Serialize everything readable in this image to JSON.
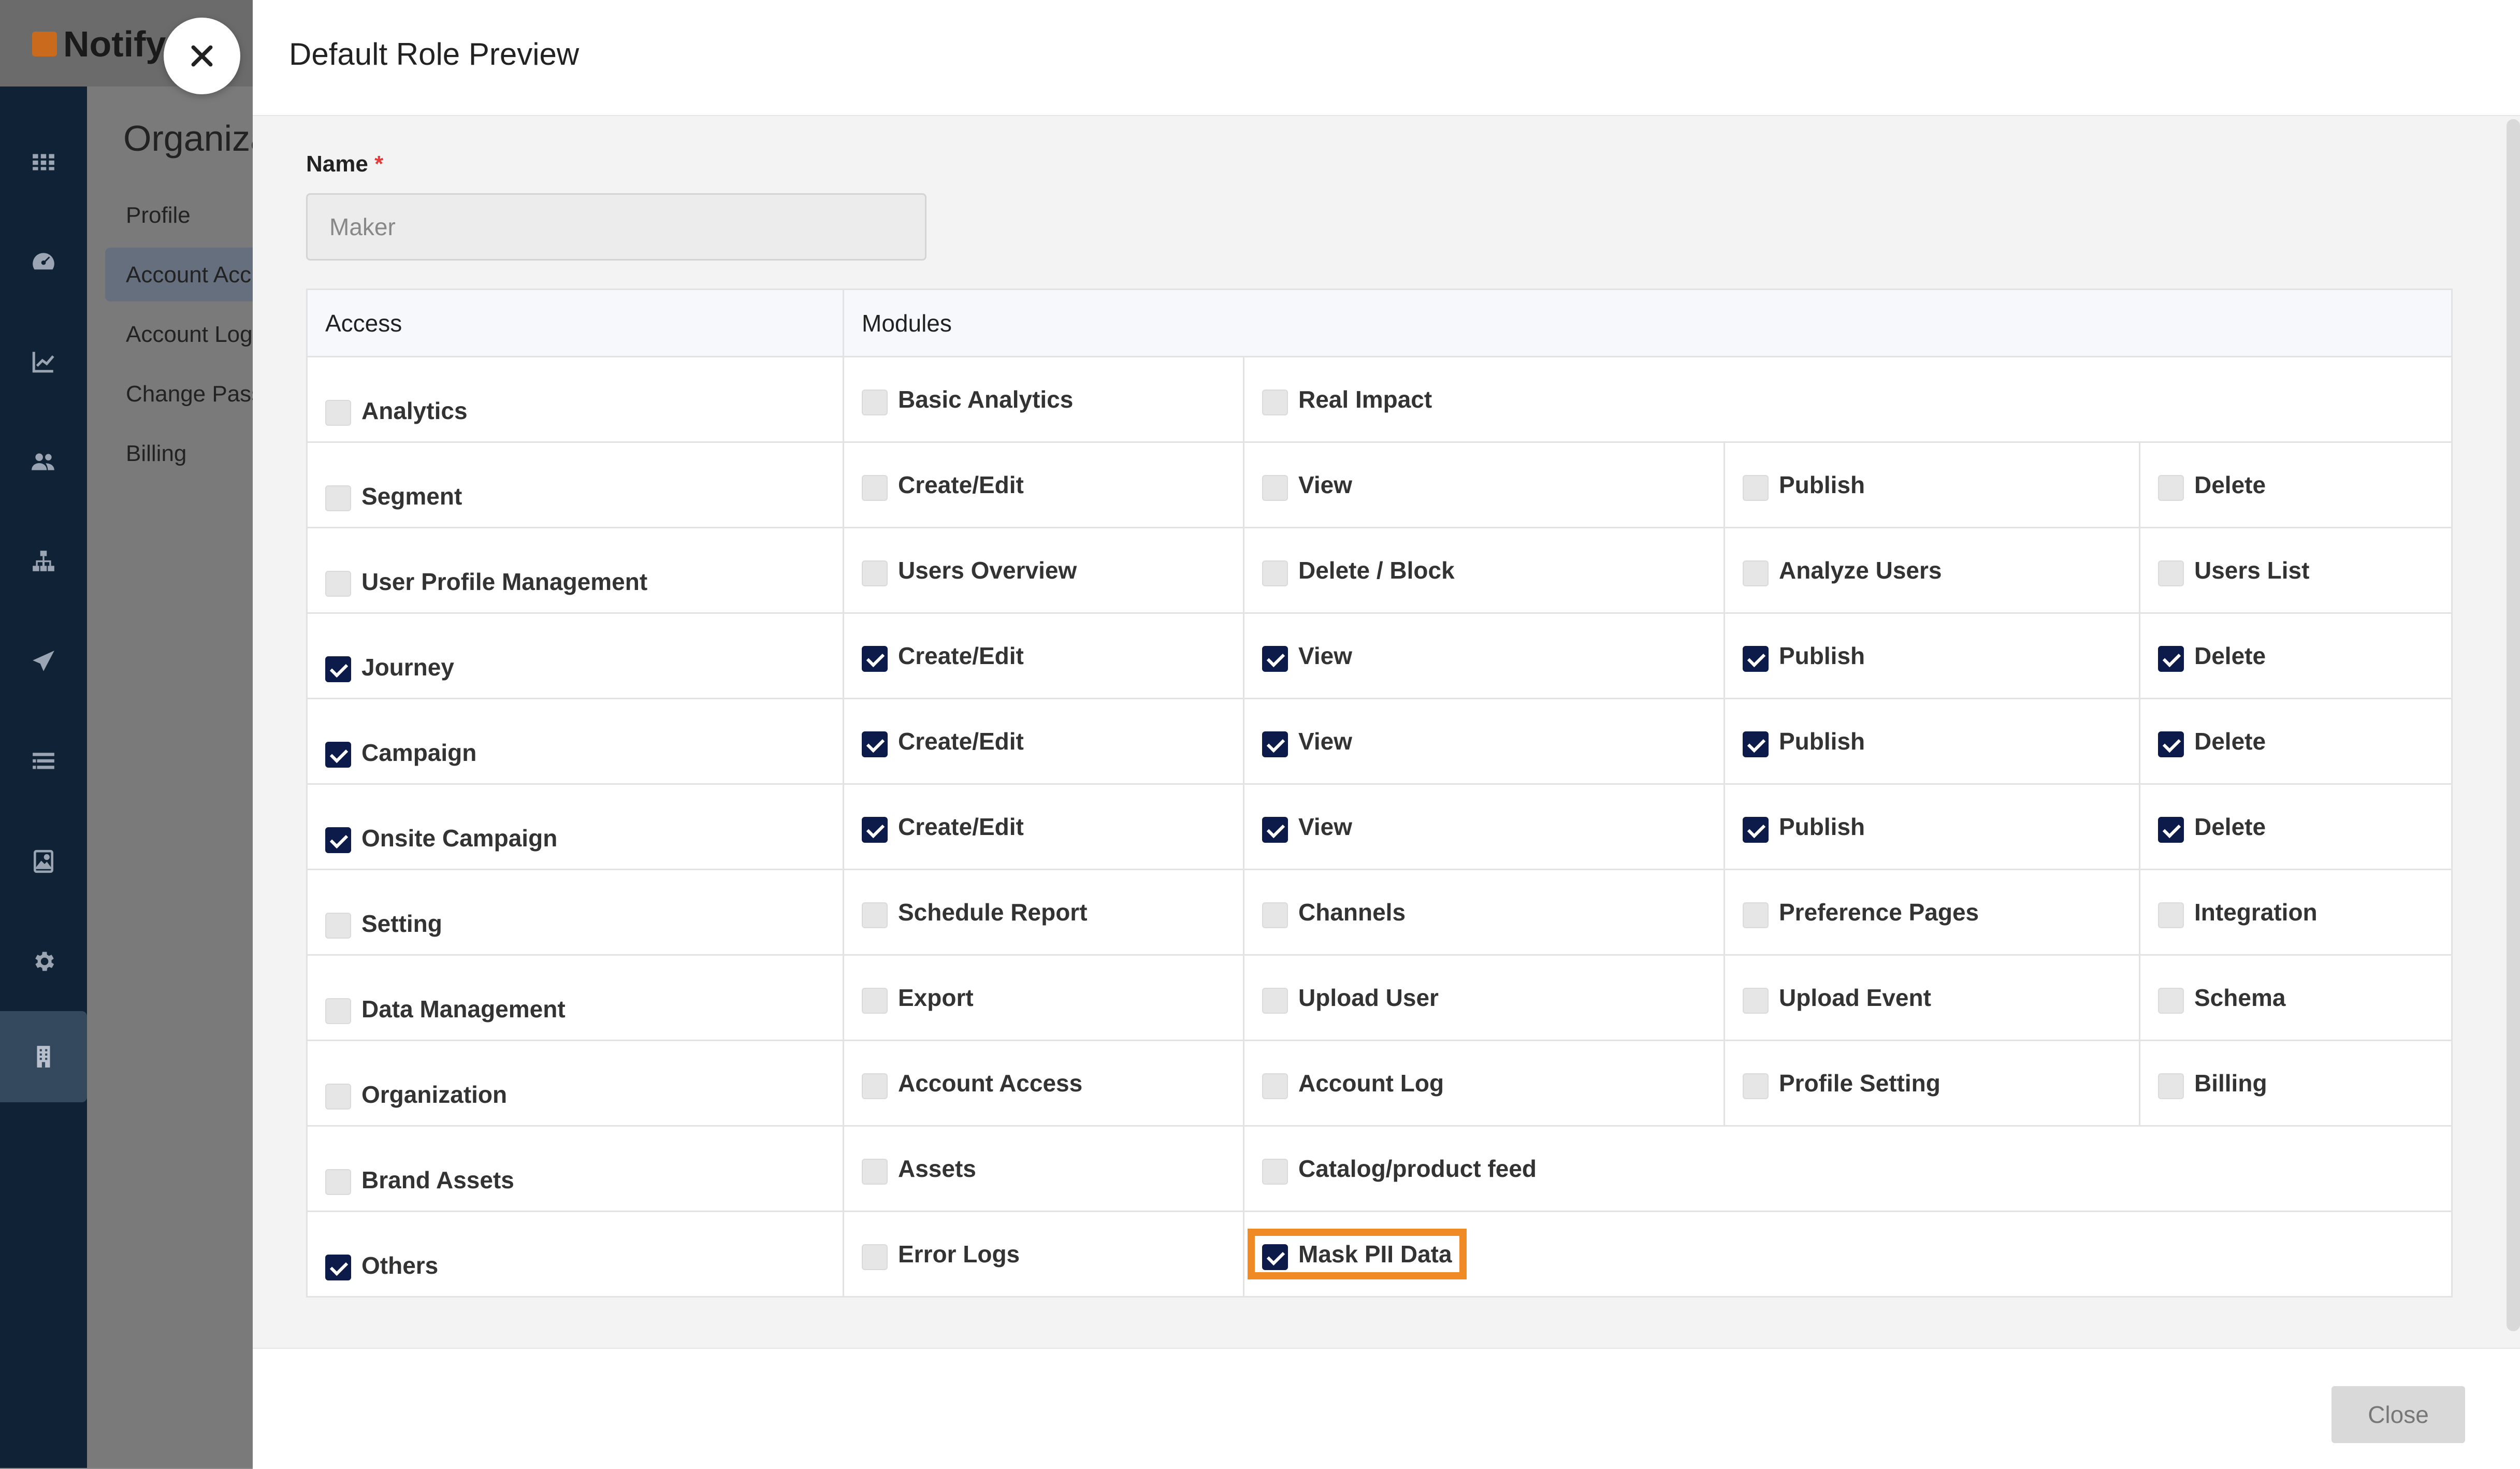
{
  "app": {
    "logo_text": "Notify"
  },
  "sidebar": {
    "icons": [
      "apps-icon",
      "dashboard-icon",
      "chart-icon",
      "users-icon",
      "hierarchy-icon",
      "send-icon",
      "list-icon",
      "image-icon",
      "gear-icon",
      "building-icon"
    ]
  },
  "subnav": {
    "title": "Organiza",
    "items": [
      {
        "label": "Profile"
      },
      {
        "label": "Account Acc"
      },
      {
        "label": "Account Log"
      },
      {
        "label": "Change Pass"
      },
      {
        "label": "Billing"
      }
    ]
  },
  "modal": {
    "title": "Default Role Preview",
    "name_label": "Name",
    "required_mark": "*",
    "name_value": "Maker",
    "close_label": "Close",
    "highlight_color": "#f08a24",
    "checkbox_checked_color": "#0d1b4a"
  },
  "table": {
    "headers": {
      "access": "Access",
      "modules": "Modules"
    },
    "rows": [
      {
        "access": {
          "label": "Analytics",
          "checked": false
        },
        "modules": [
          {
            "label": "Basic Analytics",
            "checked": false
          },
          {
            "label": "Real Impact",
            "checked": false
          }
        ]
      },
      {
        "access": {
          "label": "Segment",
          "checked": false
        },
        "modules": [
          {
            "label": "Create/Edit",
            "checked": false
          },
          {
            "label": "View",
            "checked": false
          },
          {
            "label": "Publish",
            "checked": false
          },
          {
            "label": "Delete",
            "checked": false
          }
        ]
      },
      {
        "access": {
          "label": "User Profile Management",
          "checked": false
        },
        "modules": [
          {
            "label": "Users Overview",
            "checked": false
          },
          {
            "label": "Delete / Block",
            "checked": false
          },
          {
            "label": "Analyze Users",
            "checked": false
          },
          {
            "label": "Users List",
            "checked": false
          }
        ]
      },
      {
        "access": {
          "label": "Journey",
          "checked": true
        },
        "modules": [
          {
            "label": "Create/Edit",
            "checked": true
          },
          {
            "label": "View",
            "checked": true
          },
          {
            "label": "Publish",
            "checked": true
          },
          {
            "label": "Delete",
            "checked": true
          }
        ]
      },
      {
        "access": {
          "label": "Campaign",
          "checked": true
        },
        "modules": [
          {
            "label": "Create/Edit",
            "checked": true
          },
          {
            "label": "View",
            "checked": true
          },
          {
            "label": "Publish",
            "checked": true
          },
          {
            "label": "Delete",
            "checked": true
          }
        ]
      },
      {
        "access": {
          "label": "Onsite Campaign",
          "checked": true
        },
        "modules": [
          {
            "label": "Create/Edit",
            "checked": true
          },
          {
            "label": "View",
            "checked": true
          },
          {
            "label": "Publish",
            "checked": true
          },
          {
            "label": "Delete",
            "checked": true
          }
        ]
      },
      {
        "access": {
          "label": "Setting",
          "checked": false
        },
        "modules": [
          {
            "label": "Schedule Report",
            "checked": false
          },
          {
            "label": "Channels",
            "checked": false
          },
          {
            "label": "Preference Pages",
            "checked": false
          },
          {
            "label": "Integration",
            "checked": false
          }
        ]
      },
      {
        "access": {
          "label": "Data Management",
          "checked": false
        },
        "modules": [
          {
            "label": "Export",
            "checked": false
          },
          {
            "label": "Upload User",
            "checked": false
          },
          {
            "label": "Upload Event",
            "checked": false
          },
          {
            "label": "Schema",
            "checked": false
          }
        ]
      },
      {
        "access": {
          "label": "Organization",
          "checked": false
        },
        "modules": [
          {
            "label": "Account Access",
            "checked": false
          },
          {
            "label": "Account Log",
            "checked": false
          },
          {
            "label": "Profile Setting",
            "checked": false
          },
          {
            "label": "Billing",
            "checked": false
          }
        ]
      },
      {
        "access": {
          "label": "Brand Assets",
          "checked": false
        },
        "modules": [
          {
            "label": "Assets",
            "checked": false
          },
          {
            "label": "Catalog/product feed",
            "checked": false
          }
        ]
      },
      {
        "access": {
          "label": "Others",
          "checked": true
        },
        "modules": [
          {
            "label": "Error Logs",
            "checked": false
          },
          {
            "label": "Mask PII Data",
            "checked": true,
            "highlighted": true
          }
        ]
      }
    ]
  }
}
